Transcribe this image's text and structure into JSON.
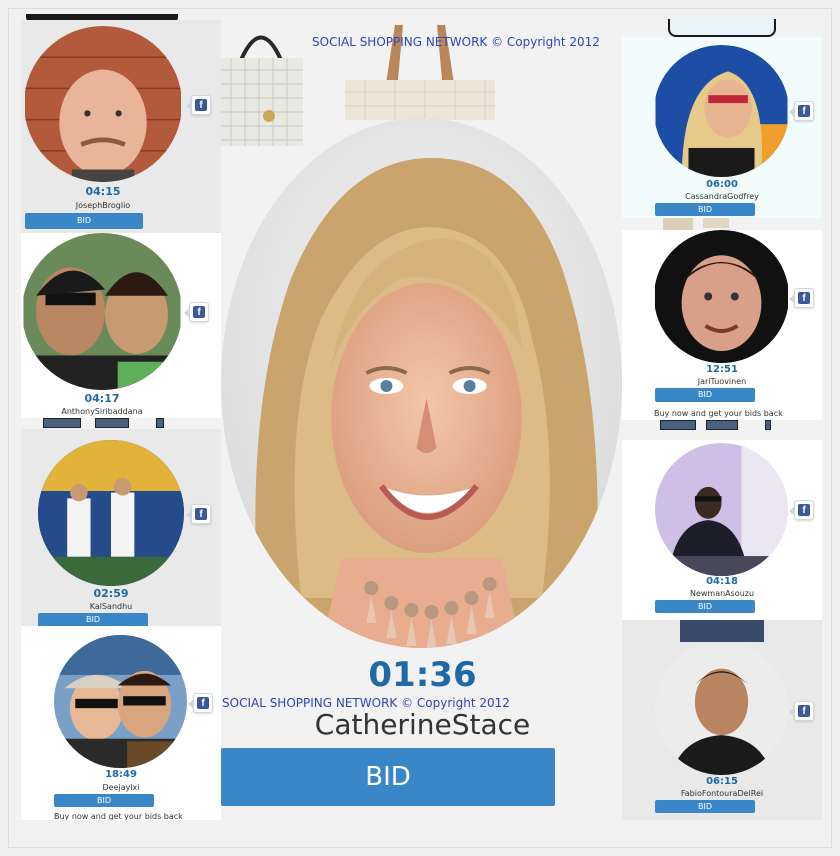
{
  "copyright": "SOCIAL SHOPPING NETWORK © Copyright 2012",
  "buy_note": "Buy now and get your bids back",
  "main": {
    "timer": "01:36",
    "username": "CatherineStace",
    "bid_label": "BID"
  },
  "left": [
    {
      "timer": "04:15",
      "username": "JosephBroglio",
      "bid_label": "BID"
    },
    {
      "timer": "04:17",
      "username": "AnthonySiribaddana",
      "bid_label": "BID"
    },
    {
      "timer": "02:59",
      "username": "KalSandhu",
      "bid_label": "BID"
    },
    {
      "timer": "18:49",
      "username": "Deejaylxi",
      "bid_label": "BID"
    }
  ],
  "right": [
    {
      "timer": "06:00",
      "username": "CassandraGodfrey",
      "bid_label": "BID"
    },
    {
      "timer": "12:51",
      "username": "JariTuovinen",
      "bid_label": "BID"
    },
    {
      "timer": "04:18",
      "username": "NewmanAsouzu",
      "bid_label": "BID"
    },
    {
      "timer": "06:15",
      "username": "FabioFontouraDelRei",
      "bid_label": "BID"
    }
  ],
  "icons": {
    "facebook": "facebook-icon"
  },
  "colors": {
    "accent": "#3a87c8",
    "timer": "#1f6aa5",
    "copyright": "#2d45b8",
    "facebook": "#3b5998"
  }
}
